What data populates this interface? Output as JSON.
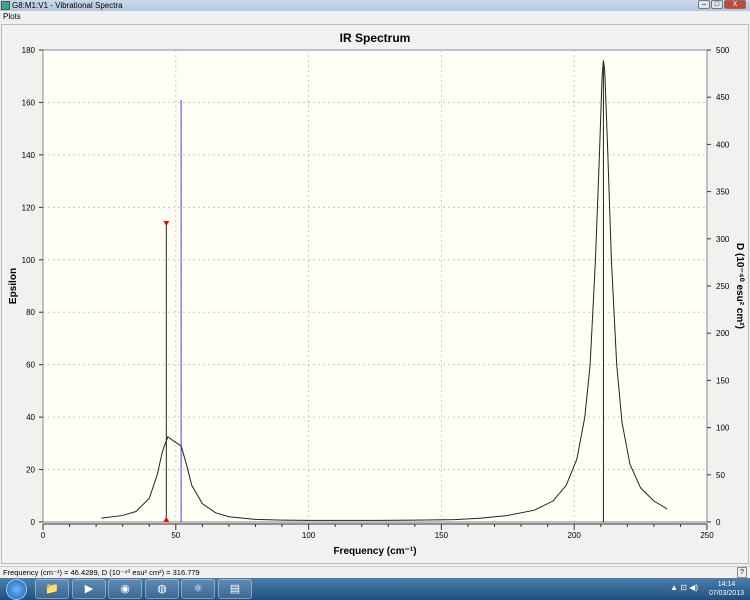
{
  "window": {
    "title": "G8:M1:V1 - Vibrational Spectra",
    "menu": [
      "Plots"
    ],
    "buttons": [
      "–",
      "□",
      "X"
    ]
  },
  "status": {
    "text": "Frequency (cm⁻¹) = 46.4289, D (10⁻⁴⁰ esu² cm²) = 316.779",
    "help": "?"
  },
  "taskbar": {
    "apps": [
      "explorer",
      "media-player",
      "chrome",
      "firefox",
      "gaussview",
      "document"
    ],
    "time": "14:14",
    "date": "07/03/2013"
  },
  "chart_data": {
    "type": "line",
    "title": "IR Spectrum",
    "xlabel": "Frequency (cm⁻¹)",
    "ylabel": "Epsilon",
    "y2label": "D (10⁻⁴⁰ esu² cm²)",
    "xlim": [
      0,
      250
    ],
    "ylim": [
      0,
      180
    ],
    "y2lim": [
      0,
      500
    ],
    "xticks": [
      0,
      50,
      100,
      150,
      200,
      250
    ],
    "yticks": [
      0,
      20,
      40,
      60,
      80,
      100,
      120,
      140,
      160,
      180
    ],
    "y2ticks": [
      0,
      50,
      100,
      150,
      200,
      250,
      300,
      350,
      400,
      450,
      500
    ],
    "grid": true,
    "spectrum": {
      "x": [
        22,
        30,
        35,
        40,
        43,
        45,
        47,
        49,
        52,
        54,
        56,
        60,
        65,
        70,
        80,
        90,
        100,
        120,
        140,
        155,
        165,
        175,
        185,
        192,
        197,
        201,
        204,
        206,
        208,
        209.5,
        210.5,
        211,
        211.5,
        212.5,
        214,
        216,
        218,
        221,
        225,
        230,
        235
      ],
      "y": [
        1.5,
        2.5,
        4,
        9,
        18,
        27,
        32.5,
        31,
        29,
        22,
        14,
        7,
        3.5,
        2,
        1,
        0.7,
        0.6,
        0.6,
        0.7,
        0.9,
        1.5,
        2.5,
        4.5,
        8,
        14,
        24,
        40,
        60,
        100,
        140,
        170,
        176,
        172,
        145,
        100,
        60,
        38,
        22,
        13,
        8,
        5
      ]
    },
    "sticks": [
      {
        "x": 46.4289,
        "D": 316.779,
        "color": "#222222",
        "selected": true
      },
      {
        "x": 52,
        "D": 447,
        "color": "#4040ff",
        "selected": false
      },
      {
        "x": 211,
        "D": 489,
        "color": "#222222",
        "selected": false
      }
    ],
    "colors": {
      "plot_bg": "#fffff5",
      "grid": "#c8c8c8",
      "curve": "#222222",
      "marker": "#ff0000"
    }
  }
}
